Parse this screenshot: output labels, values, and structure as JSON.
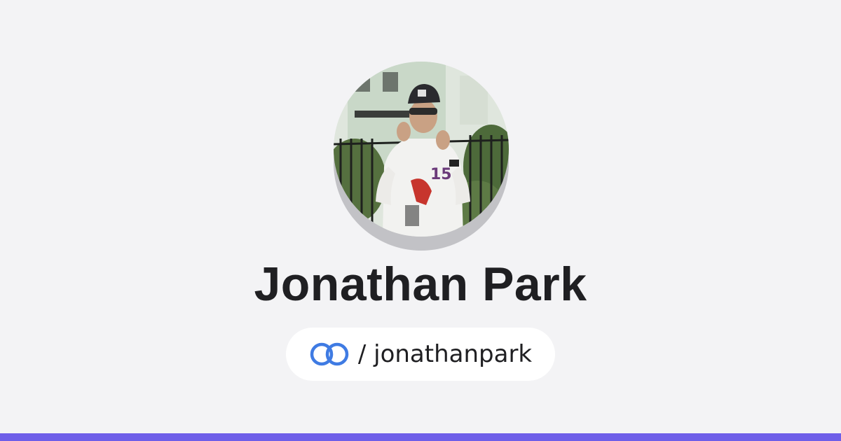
{
  "profile": {
    "display_name": "Jonathan Park",
    "handle": "/ jonathanpark",
    "avatar": "profile-photo"
  },
  "icons": {
    "logo": "interlinked-rings-icon"
  },
  "colors": {
    "background": "#f3f3f5",
    "accent_bar": "#6e5ee8",
    "logo_ring": "#3f7be3",
    "text": "#1f1f22"
  }
}
